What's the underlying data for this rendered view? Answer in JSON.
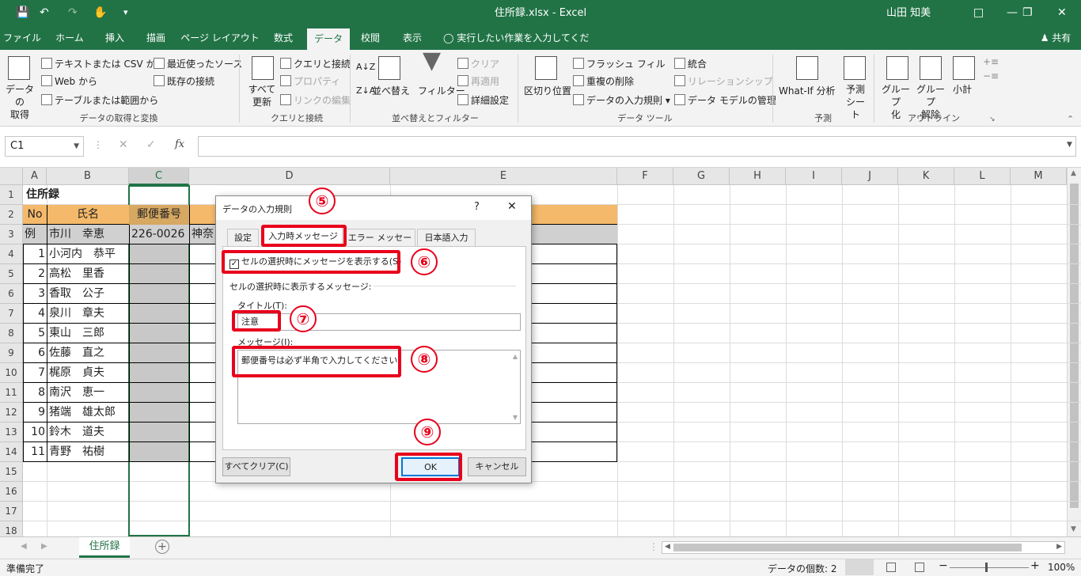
{
  "window": {
    "title": "住所録.xlsx - Excel",
    "user": "山田 知美"
  },
  "tabs": [
    "ファイル",
    "ホーム",
    "挿入",
    "描画",
    "ページ レイアウト",
    "数式",
    "データ",
    "校閲",
    "表示"
  ],
  "tell_me": "実行したい作業を入力してください",
  "share": "共有",
  "ribbon": {
    "get_data": "データの\n取得",
    "from_text_csv": "テキストまたは CSV から",
    "from_web": "Web から",
    "from_table": "テーブルまたは範囲から",
    "recent_sources": "最近使ったソース",
    "existing_conn": "既存の接続",
    "group_get": "データの取得と変換",
    "refresh_all": "すべて\n更新",
    "queries_conn": "クエリと接続",
    "properties": "プロパティ",
    "edit_links": "リンクの編集",
    "group_queries": "クエリと接続",
    "sort": "並べ替え",
    "filter": "フィルター",
    "clear": "クリア",
    "reapply": "再適用",
    "advanced": "詳細設定",
    "group_sort": "並べ替えとフィルター",
    "text_to_columns": "区切り位置",
    "flash_fill": "フラッシュ フィル",
    "remove_dup": "重複の削除",
    "data_validation": "データの入力規則",
    "consolidate": "統合",
    "relationships": "リレーションシップ",
    "data_model": "データ モデルの管理",
    "group_tools": "データ ツール",
    "whatif": "What-If 分析",
    "forecast_sheet": "予測\nシート",
    "group_forecast": "予測",
    "group_btn": "グループ\n化",
    "ungroup_btn": "グループ\n解除",
    "subtotal": "小計",
    "group_outline": "アウトライン"
  },
  "namebox": "C1",
  "columns": [
    "A",
    "B",
    "C",
    "D",
    "E",
    "F",
    "G",
    "H",
    "I",
    "J",
    "K",
    "L",
    "M"
  ],
  "rows": [
    "1",
    "2",
    "3",
    "4",
    "5",
    "6",
    "7",
    "8",
    "9",
    "10",
    "11",
    "12",
    "13",
    "14",
    "15",
    "16",
    "17",
    "18"
  ],
  "sheet": {
    "title": "住所録",
    "header_no": "No",
    "header_name": "氏名",
    "header_zip": "郵便番号",
    "example_label": "例",
    "example_name": "市川　幸恵",
    "example_zip": "226-0026",
    "example_addr": "神奈",
    "entries": [
      {
        "no": "1",
        "name": "小河内　恭平"
      },
      {
        "no": "2",
        "name": "高松　里香"
      },
      {
        "no": "3",
        "name": "香取　公子"
      },
      {
        "no": "4",
        "name": "泉川　章夫"
      },
      {
        "no": "5",
        "name": "東山　三郎"
      },
      {
        "no": "6",
        "name": "佐藤　直之"
      },
      {
        "no": "7",
        "name": "梶原　貞夫"
      },
      {
        "no": "8",
        "name": "南沢　恵一"
      },
      {
        "no": "9",
        "name": "猪端　雄太郎"
      },
      {
        "no": "10",
        "name": "鈴木　道夫"
      },
      {
        "no": "11",
        "name": "青野　祐樹"
      }
    ]
  },
  "sheet_tab": "住所録",
  "status": {
    "ready": "準備完了",
    "count": "データの個数: 2",
    "zoom": "100%"
  },
  "dialog": {
    "title": "データの入力規則",
    "help": "?",
    "tabs": [
      "設定",
      "入力時メッセージ",
      "エラー メッセージ",
      "日本語入力"
    ],
    "checkbox_label": "セルの選択時にメッセージを表示する(S)",
    "section_label": "セルの選択時に表示するメッセージ:",
    "title_label": "タイトル(T):",
    "title_value": "注意",
    "message_label": "メッセージ(I):",
    "message_value": "郵便番号は必ず半角で入力してください！",
    "clear_all": "すべてクリア(C)",
    "ok": "OK",
    "cancel": "キャンセル"
  },
  "annotations": [
    "⑤",
    "⑥",
    "⑦",
    "⑧",
    "⑨"
  ],
  "colors": {
    "excel_green": "#217346",
    "header_fill": "#f4b96a",
    "red": "#e8001c",
    "selected_col": "#c8c8c8"
  }
}
